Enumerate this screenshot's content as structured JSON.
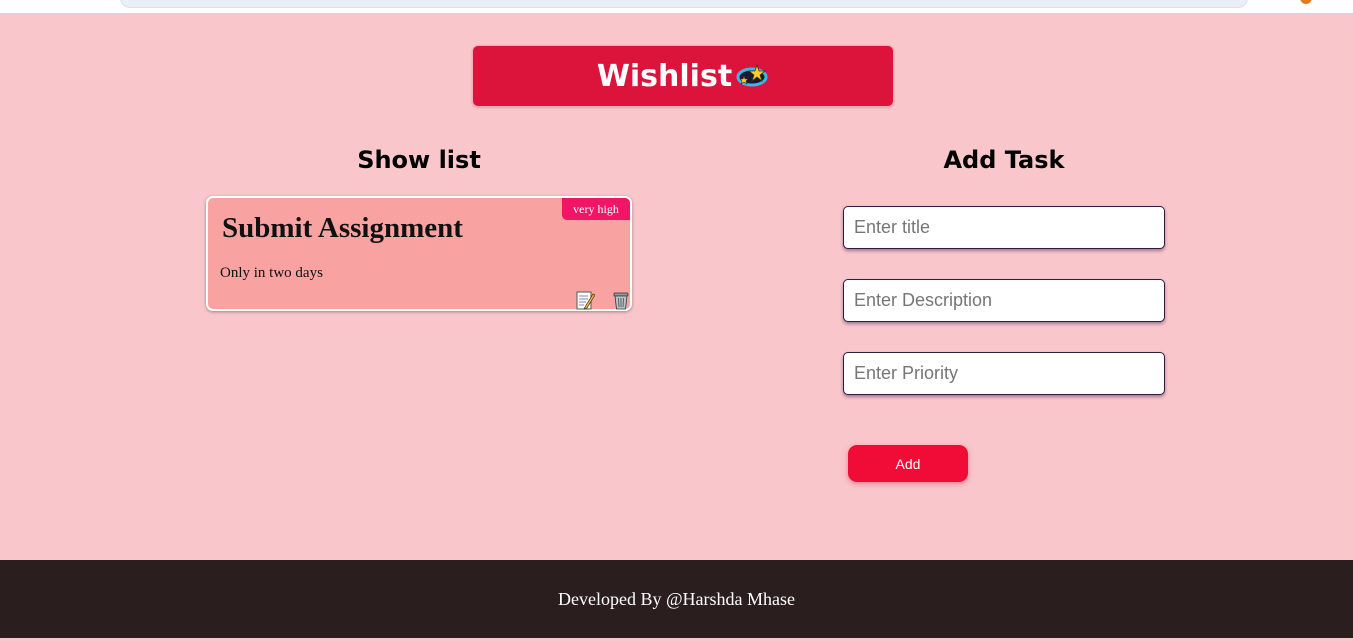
{
  "header": {
    "title": "Wishlist",
    "emoji_icon": "dizzy-star-icon"
  },
  "show_list": {
    "heading": "Show list",
    "tasks": [
      {
        "title": "Submit Assignment",
        "description": "Only in two days",
        "priority": "very high",
        "edit_icon": "memo-icon",
        "delete_icon": "wastebasket-icon"
      }
    ]
  },
  "add_task": {
    "heading": "Add Task",
    "title_placeholder": "Enter title",
    "description_placeholder": "Enter Description",
    "priority_placeholder": "Enter Priority",
    "add_label": "Add"
  },
  "footer": {
    "text": "Developed By @Harshda Mhase"
  },
  "colors": {
    "background": "#f9c6cb",
    "banner": "#dc143c",
    "card": "#f8a3a2",
    "badge": "#ee1665",
    "button": "#f00c36",
    "footer": "#2a1f1e"
  }
}
